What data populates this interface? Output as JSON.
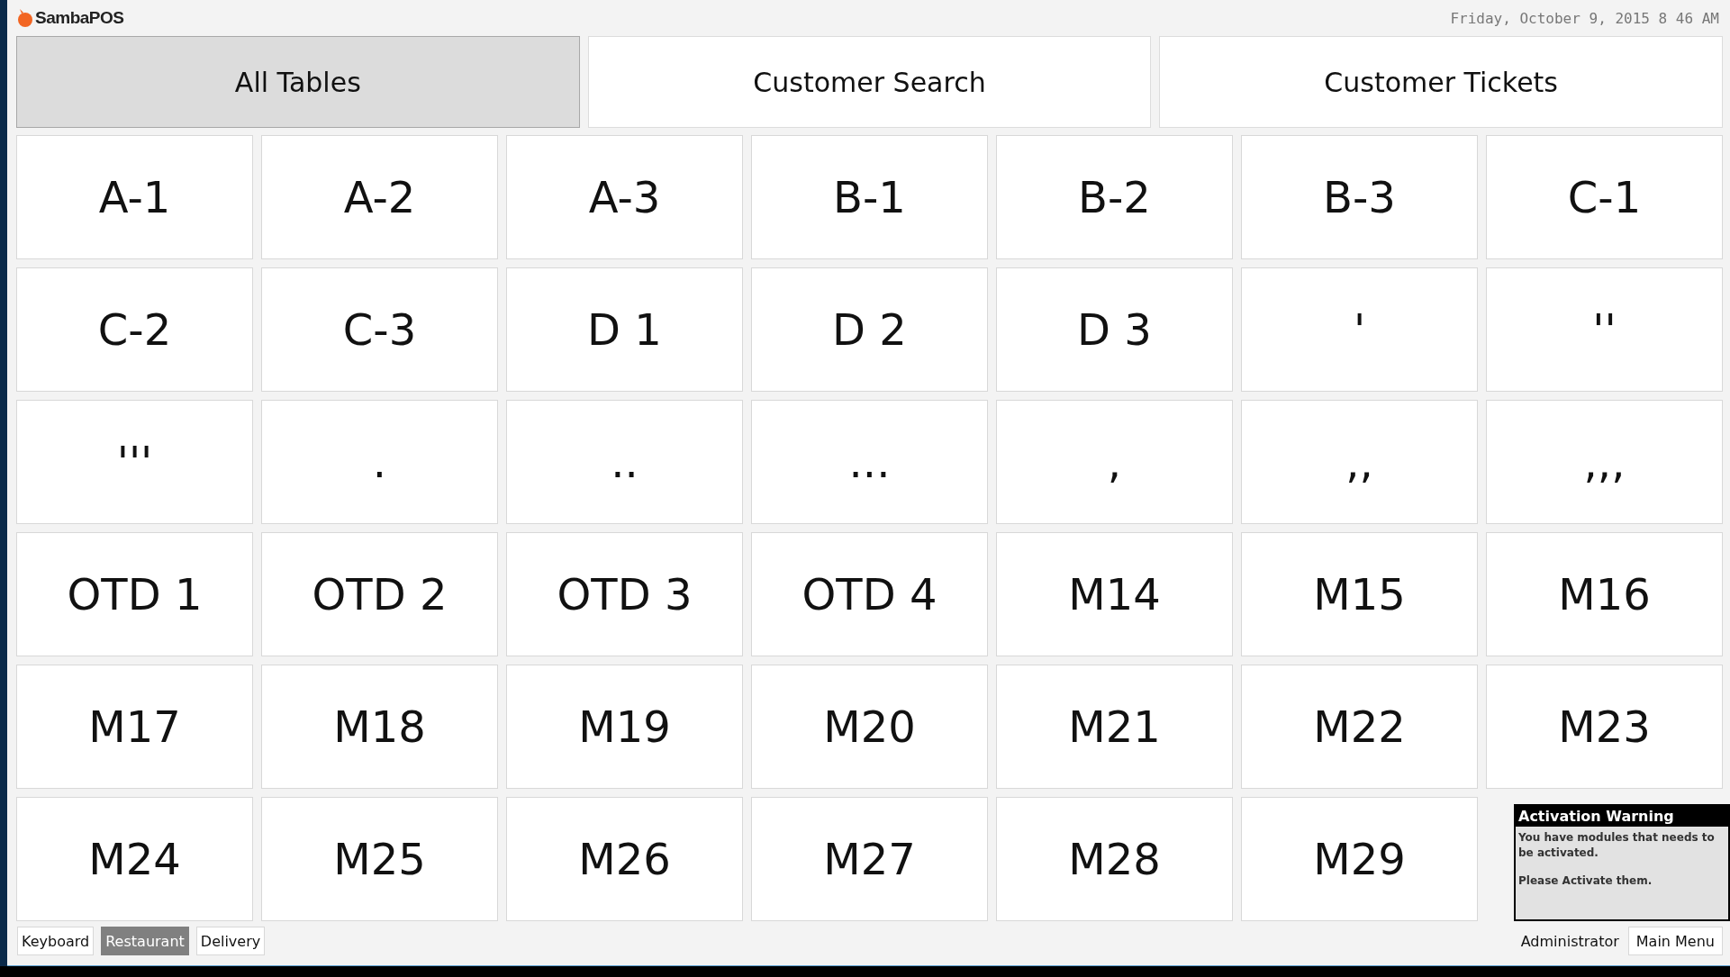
{
  "app": {
    "title": "SambaPOS",
    "datetime": "Friday, October 9, 2015 8 46 AM"
  },
  "tabs": [
    {
      "label": "All Tables",
      "selected": true
    },
    {
      "label": "Customer Search",
      "selected": false
    },
    {
      "label": "Customer Tickets",
      "selected": false
    }
  ],
  "tables": [
    "A-1",
    "A-2",
    "A-3",
    "B-1",
    "B-2",
    "B-3",
    "C-1",
    "C-2",
    "C-3",
    "D 1",
    "D 2",
    "D 3",
    "'",
    "''",
    "'''",
    ".",
    "..",
    "...",
    ",",
    ",,",
    ",,,",
    "OTD 1",
    "OTD 2",
    "OTD 3",
    "OTD 4",
    "M14",
    "M15",
    "M16",
    "M17",
    "M18",
    "M19",
    "M20",
    "M21",
    "M22",
    "M23",
    "M24",
    "M25",
    "M26",
    "M27",
    "M28",
    "M29"
  ],
  "footer": {
    "buttons": [
      {
        "label": "Keyboard",
        "selected": false
      },
      {
        "label": "Restaurant",
        "selected": true
      },
      {
        "label": "Delivery",
        "selected": false
      }
    ],
    "user": "Administrator",
    "menu": "Main Menu"
  },
  "warning": {
    "title": "Activation Warning",
    "message": "You have modules that needs to be activated.",
    "note": "Please Activate them."
  }
}
